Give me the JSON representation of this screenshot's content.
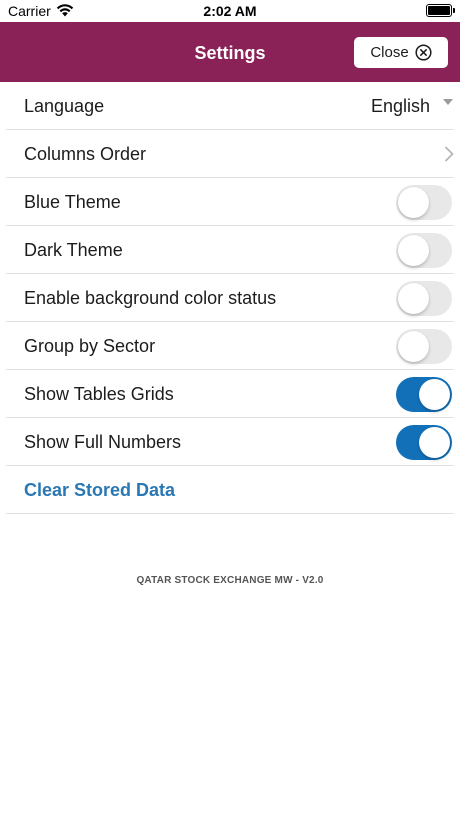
{
  "status_bar": {
    "carrier": "Carrier",
    "time": "2:02 AM"
  },
  "header": {
    "title": "Settings",
    "close_label": "Close",
    "background": "#8a2258"
  },
  "settings": {
    "language": {
      "label": "Language",
      "value": "English"
    },
    "columns_order": {
      "label": "Columns Order"
    },
    "toggles": [
      {
        "label": "Blue Theme",
        "on": false
      },
      {
        "label": "Dark Theme",
        "on": false
      },
      {
        "label": "Enable background color status",
        "on": false
      },
      {
        "label": "Group by Sector",
        "on": false
      },
      {
        "label": "Show Tables Grids",
        "on": true
      },
      {
        "label": "Show Full Numbers",
        "on": true
      }
    ],
    "clear_label": "Clear Stored Data"
  },
  "footer": {
    "version_text": "QATAR STOCK EXCHANGE MW - V2.0"
  },
  "colors": {
    "accent": "#1270b9",
    "link": "#2a78b3",
    "toggle_off": "#e8e8e8"
  }
}
